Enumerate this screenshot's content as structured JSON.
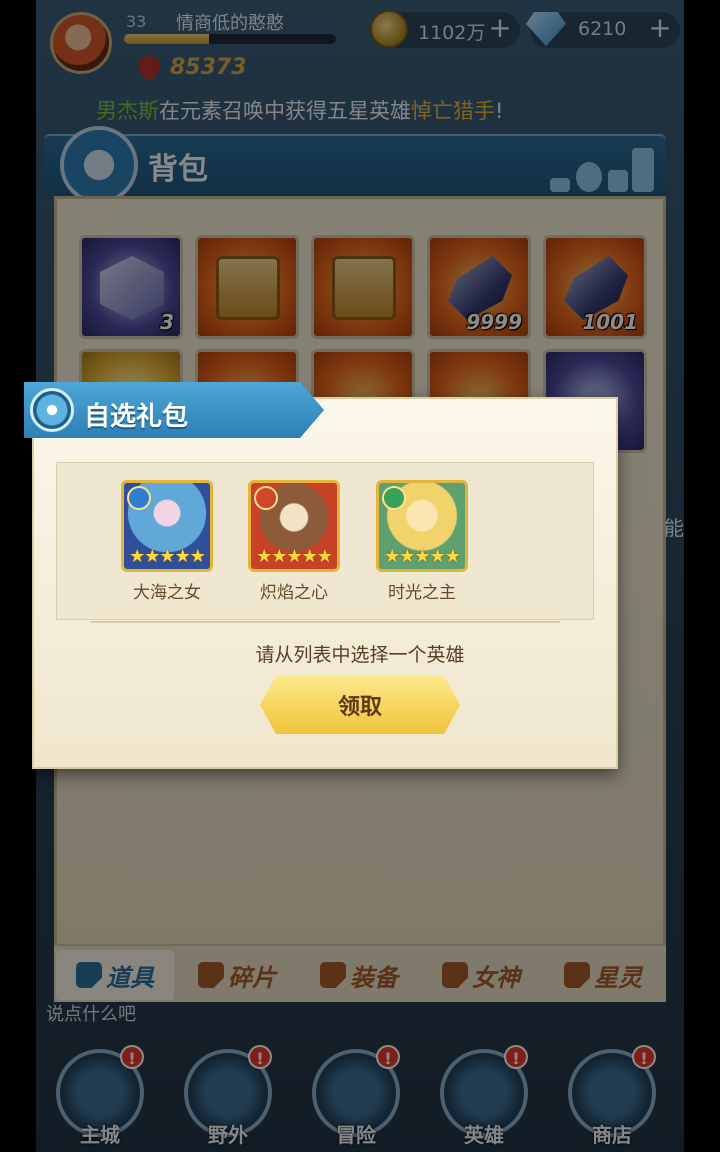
{
  "player": {
    "level": "33",
    "name": "情商低的憨憨",
    "xp_fraction": 0.4,
    "power": "85373"
  },
  "resources": {
    "gold": "1102万",
    "gems": "6210",
    "plus_symbol": "+"
  },
  "announcement": {
    "name_fragment": "男杰斯",
    "middle": "在元素召唤中获得五星英雄",
    "hero": "悼亡猎手",
    "end": "!"
  },
  "backpack": {
    "title": "背包",
    "items": [
      {
        "type": "rune",
        "rarity": "purple",
        "count": "3"
      },
      {
        "type": "chest",
        "rarity": "orange",
        "count": ""
      },
      {
        "type": "chest",
        "rarity": "orange",
        "count": ""
      },
      {
        "type": "crystal",
        "rarity": "orange",
        "count": "9999"
      },
      {
        "type": "crystal",
        "rarity": "orange",
        "count": "1001"
      }
    ],
    "tabs": [
      {
        "label": "道具",
        "icon": "item-tab-icon",
        "active": true
      },
      {
        "label": "碎片",
        "icon": "fragment-tab-icon",
        "active": false
      },
      {
        "label": "装备",
        "icon": "equipment-tab-icon",
        "active": false
      },
      {
        "label": "女神",
        "icon": "goddess-tab-icon",
        "active": false
      },
      {
        "label": "星灵",
        "icon": "star-spirit-tab-icon",
        "active": false
      }
    ]
  },
  "chat": {
    "placeholder": "说点什么吧"
  },
  "side_text": "能",
  "modal": {
    "title": "自选礼包",
    "heroes": [
      {
        "name": "大海之女",
        "element": "water-element-icon",
        "stars": "★★★★★"
      },
      {
        "name": "炽焰之心",
        "element": "fire-element-icon",
        "stars": "★★★★★"
      },
      {
        "name": "时光之主",
        "element": "wind-element-icon",
        "stars": "★★★★★"
      }
    ],
    "prompt": "请从列表中选择一个英雄",
    "claim_button": "领取"
  },
  "bottom_nav": [
    {
      "label": "主城",
      "badge": "!"
    },
    {
      "label": "野外",
      "badge": "!"
    },
    {
      "label": "冒险",
      "badge": "!"
    },
    {
      "label": "英雄",
      "badge": "!"
    },
    {
      "label": "商店",
      "badge": "!"
    }
  ],
  "colors": {
    "header_blue": "#2b6d98",
    "panel_cream": "#f3ecd6",
    "claim_yellow": "#f0c43a",
    "power_gold": "#d8ab4a",
    "badge_red": "#e23a2a"
  }
}
